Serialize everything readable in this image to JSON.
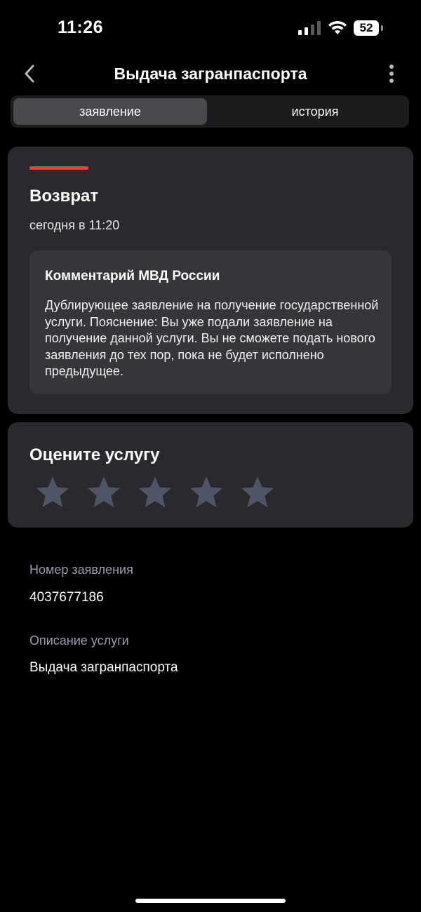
{
  "status_bar": {
    "time": "11:26",
    "battery": "52",
    "icons": [
      "cellular-signal-icon",
      "wifi-icon",
      "battery-icon"
    ]
  },
  "nav": {
    "title": "Выдача загранпаспорта",
    "back_icon": "chevron-left-icon",
    "more_icon": "more-vertical-icon"
  },
  "tabs": [
    {
      "label": "заявление",
      "selected": true
    },
    {
      "label": "история",
      "selected": false
    }
  ],
  "status_card": {
    "accent_color": "#e8413c",
    "title": "Возврат",
    "time": "сегодня в 11:20",
    "comment": {
      "title": "Комментарий МВД России",
      "text": "Дублирующее заявление на получение государственной услуги. Пояснение: Вы уже подали заявление на получение данной услуги. Вы не сможете подать нового заявления до тех пор, пока не будет исполнено предыдущее."
    }
  },
  "rating": {
    "title": "Оцените услугу",
    "stars_total": 5,
    "stars_selected": 0,
    "star_color": "#4f5466"
  },
  "details": [
    {
      "label": "Номер заявления",
      "value": "4037677186"
    },
    {
      "label": "Описание услуги",
      "value": "Выдача загранпаспорта"
    }
  ],
  "colors": {
    "background": "#000000",
    "card": "#2a2a2e",
    "label": "#9a9bb0"
  }
}
